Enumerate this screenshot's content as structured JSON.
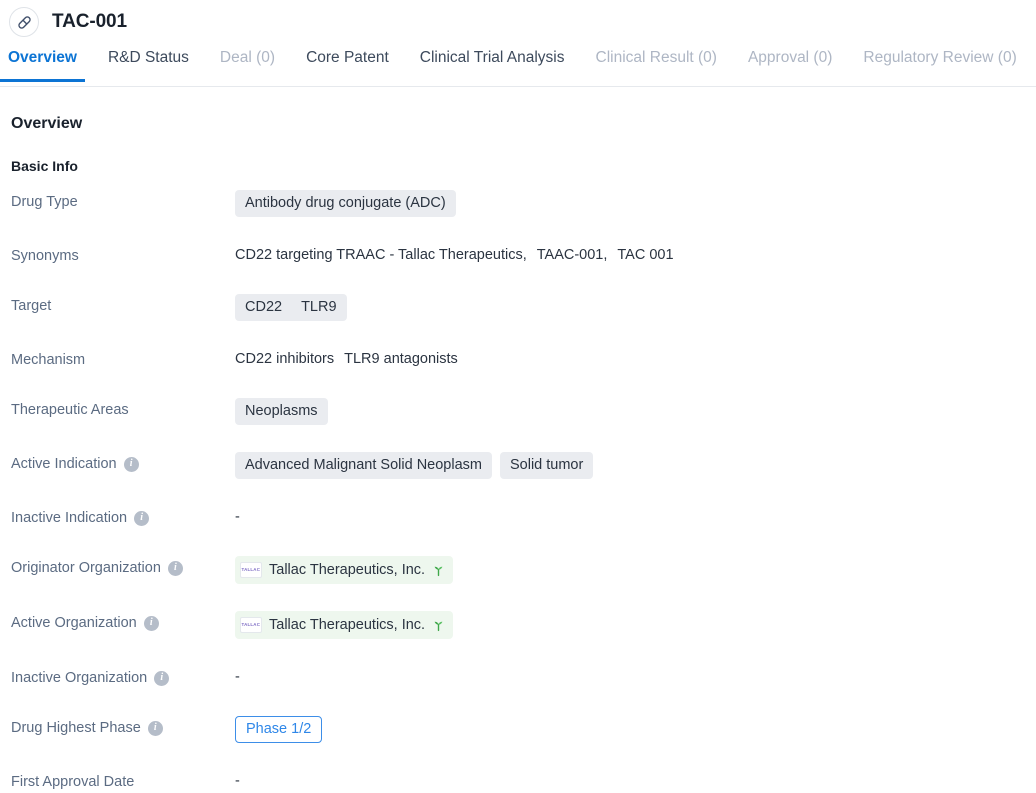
{
  "header": {
    "drug_icon": "pill-capsule-icon",
    "title": "TAC-001"
  },
  "tabs": [
    {
      "label": "Overview",
      "state": "active"
    },
    {
      "label": "R&D Status",
      "state": "normal"
    },
    {
      "label": "Deal (0)",
      "state": "disabled"
    },
    {
      "label": "Core Patent",
      "state": "normal"
    },
    {
      "label": "Clinical Trial Analysis",
      "state": "normal"
    },
    {
      "label": "Clinical Result (0)",
      "state": "disabled"
    },
    {
      "label": "Approval (0)",
      "state": "disabled"
    },
    {
      "label": "Regulatory Review (0)",
      "state": "disabled"
    }
  ],
  "overview": {
    "section_title": "Overview",
    "subsection_title": "Basic Info",
    "rows": {
      "drug_type": {
        "label": "Drug Type",
        "chips": [
          "Antibody drug conjugate (ADC)"
        ]
      },
      "synonyms": {
        "label": "Synonyms",
        "items": [
          "CD22 targeting TRAAC - Tallac Therapeutics,",
          "TAAC-001,",
          "TAC 001"
        ]
      },
      "target": {
        "label": "Target",
        "group": [
          "CD22",
          "TLR9"
        ]
      },
      "mechanism": {
        "label": "Mechanism",
        "items": [
          "CD22 inhibitors",
          "TLR9 antagonists"
        ]
      },
      "therapeutic": {
        "label": "Therapeutic Areas",
        "chips": [
          "Neoplasms"
        ]
      },
      "active_ind": {
        "label": "Active Indication",
        "chips": [
          "Advanced Malignant Solid Neoplasm",
          "Solid tumor"
        ],
        "has_info": true
      },
      "inactive_ind": {
        "label": "Inactive Indication",
        "value": "-",
        "has_info": true
      },
      "originator_org": {
        "label": "Originator Organization",
        "org": "Tallac Therapeutics, Inc.",
        "logo_text": "TALLAC",
        "has_info": true
      },
      "active_org": {
        "label": "Active Organization",
        "org": "Tallac Therapeutics, Inc.",
        "logo_text": "TALLAC",
        "has_info": true
      },
      "inactive_org": {
        "label": "Inactive Organization",
        "value": "-",
        "has_info": true
      },
      "highest_phase": {
        "label": "Drug Highest Phase",
        "button": "Phase 1/2",
        "has_info": true
      },
      "first_approval": {
        "label": "First Approval Date",
        "value": "-"
      }
    }
  },
  "colors": {
    "accent": "#0c74d4",
    "label": "#5b6b82",
    "text": "#2b3441",
    "chip_bg": "#eaecf0",
    "org_bg": "#eef7ee",
    "sprout": "#3fa84a",
    "info_bg": "#b5bdc9"
  }
}
